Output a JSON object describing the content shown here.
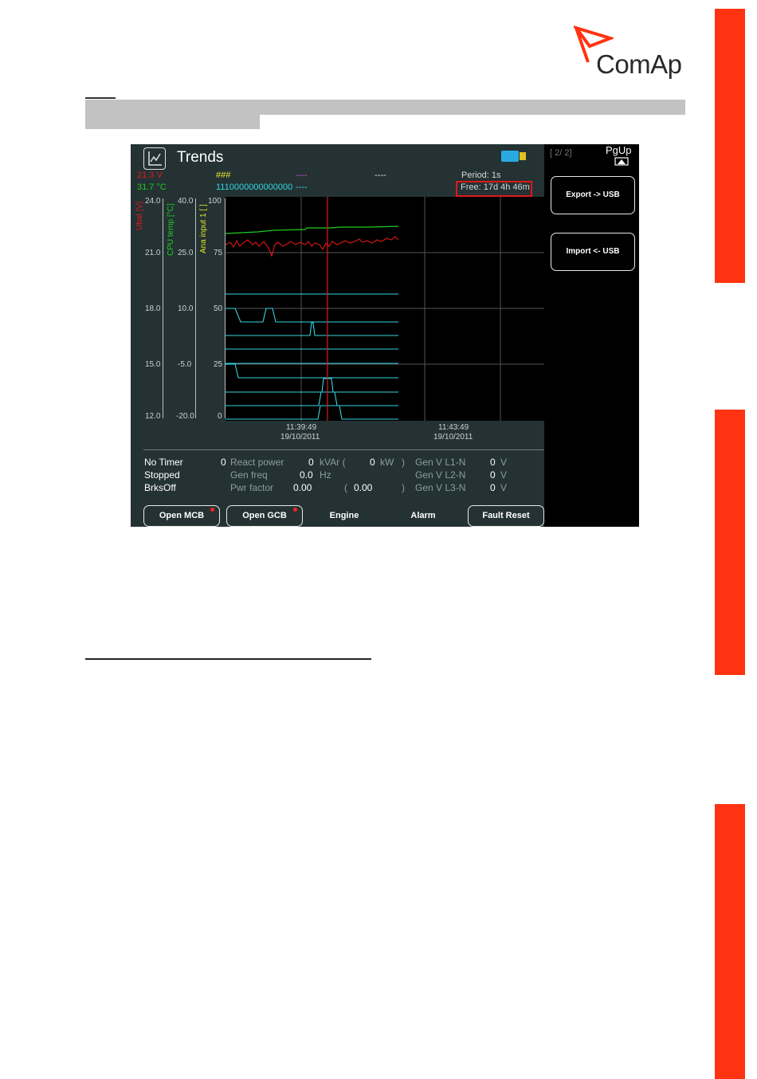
{
  "logo": {
    "text": "ComAp"
  },
  "screen": {
    "title": "Trends",
    "top_left": {
      "ubat": "21.3 V",
      "cpu": "31.7 °C"
    },
    "top_mid": {
      "hash": "###",
      "dash1": "----",
      "dash2": "----",
      "bits": "1110000000000000",
      "dash3": "----"
    },
    "period": "Period: 1s",
    "free": "Free: 17d 4h 46m",
    "axes": {
      "ubat_label": "Ubat [V]",
      "cpu_label": "CPU temp [°C]",
      "ana_label": "Ana input 1 [ ]",
      "ubat_ticks": [
        "24.0",
        "21.0",
        "18.0",
        "15.0",
        "12.0"
      ],
      "cpu_ticks": [
        "40.0",
        "25.0",
        "10.0",
        "-5.0",
        "-20.0"
      ],
      "ana_ticks": [
        "100",
        "75",
        "50",
        "25",
        "0"
      ]
    },
    "time_labels": [
      {
        "time": "11:39:49",
        "date": "19/10/2011"
      },
      {
        "time": "11:43:49",
        "date": "19/10/2011"
      }
    ],
    "status": {
      "col1": [
        "No Timer",
        "Stopped",
        "BrksOff"
      ],
      "react_power": {
        "value": "0",
        "label": "React power",
        "kvar_value": "0",
        "kvar_unit": "kVAr (",
        "kw_value": "0",
        "kw_unit": "kW",
        "paren": ")"
      },
      "gen_freq": {
        "label": "Gen freq",
        "value": "0.0",
        "unit": "Hz"
      },
      "pwr_factor": {
        "label": "Pwr factor",
        "value": "0.00",
        "open": "(",
        "value2": "0.00",
        "close": ")"
      },
      "gen_v": [
        {
          "label": "Gen V L1-N",
          "value": "0",
          "unit": "V"
        },
        {
          "label": "Gen V L2-N",
          "value": "0",
          "unit": "V"
        },
        {
          "label": "Gen V L3-N",
          "value": "0",
          "unit": "V"
        }
      ]
    },
    "bottom_buttons": {
      "open_mcb": "Open MCB",
      "open_gcb": "Open GCB",
      "engine": "Engine",
      "alarm": "Alarm",
      "fault_reset": "Fault Reset"
    },
    "side": {
      "page": "[ 2/ 2]",
      "pgup": "PgUp",
      "export": "Export -> USB",
      "import": "Import <- USB"
    },
    "colors": {
      "ubat": "#e01818",
      "cpu": "#22cc22",
      "ana": "#e8e820",
      "binary": "#33d6e0"
    }
  }
}
